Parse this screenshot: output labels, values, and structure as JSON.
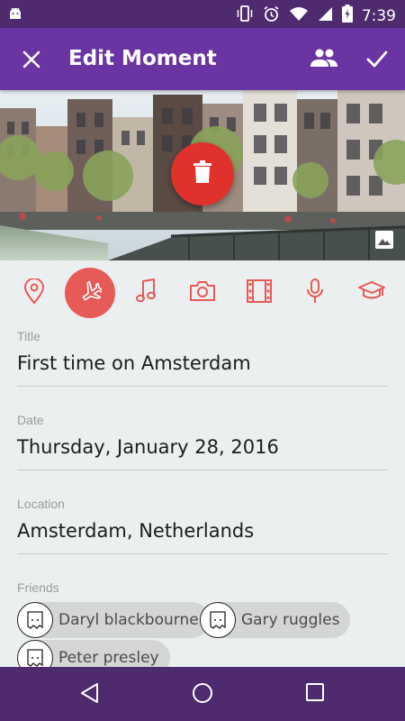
{
  "status_bar": {
    "time": "7:39",
    "icons": [
      "android-icon",
      "vibrate-icon",
      "alarm-icon",
      "wifi-icon",
      "signal-icon",
      "battery-charging-icon"
    ]
  },
  "app_bar": {
    "title": "Edit Moment",
    "close_icon": "close-icon",
    "friends_icon": "people-icon",
    "confirm_icon": "check-icon"
  },
  "hero": {
    "image": "canal-houses-photo",
    "delete_icon": "trash-icon",
    "change_image_icon": "image-icon"
  },
  "categories": [
    {
      "name": "location",
      "icon": "location-pin-icon",
      "selected": false
    },
    {
      "name": "travel",
      "icon": "airplane-icon",
      "selected": true
    },
    {
      "name": "music",
      "icon": "music-note-icon",
      "selected": false
    },
    {
      "name": "photo",
      "icon": "camera-icon",
      "selected": false
    },
    {
      "name": "film",
      "icon": "film-icon",
      "selected": false
    },
    {
      "name": "audio",
      "icon": "microphone-icon",
      "selected": false
    },
    {
      "name": "education",
      "icon": "graduation-cap-icon",
      "selected": false
    }
  ],
  "form": {
    "title": {
      "label": "Title",
      "value": "First time on Amsterdam"
    },
    "date": {
      "label": "Date",
      "value": "Thursday, January 28, 2016"
    },
    "location": {
      "label": "Location",
      "value": "Amsterdam, Netherlands"
    },
    "friends_label": "Friends",
    "friends": [
      {
        "name": "Daryl blackbourne"
      },
      {
        "name": "Gary ruggles"
      },
      {
        "name": "Peter presley"
      }
    ]
  },
  "colors": {
    "app_bar": "#6a35a3",
    "status_bar": "#4e2a6f",
    "accent": "#e65a57",
    "fab": "#e0312c"
  },
  "nav_bar": {
    "icons": [
      "back-icon",
      "home-icon",
      "recents-icon"
    ]
  }
}
